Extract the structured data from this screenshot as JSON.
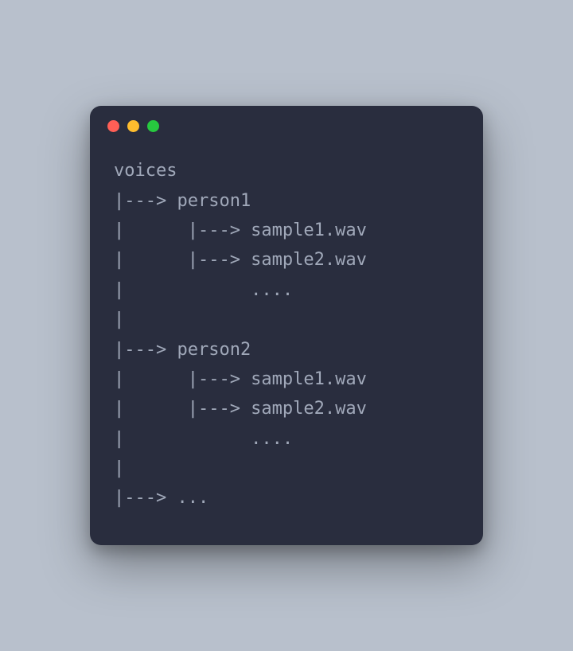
{
  "terminal": {
    "lines": [
      "voices",
      "|---> person1",
      "|      |---> sample1.wav",
      "|      |---> sample2.wav",
      "|            ....",
      "|",
      "|---> person2",
      "|      |---> sample1.wav",
      "|      |---> sample2.wav",
      "|            ....",
      "|",
      "|---> ..."
    ]
  },
  "colors": {
    "background": "#b8c0cc",
    "terminal_bg": "#292d3e",
    "text": "#a0a8b9",
    "dot_red": "#ff5f56",
    "dot_yellow": "#ffbd2e",
    "dot_green": "#27c93f"
  }
}
